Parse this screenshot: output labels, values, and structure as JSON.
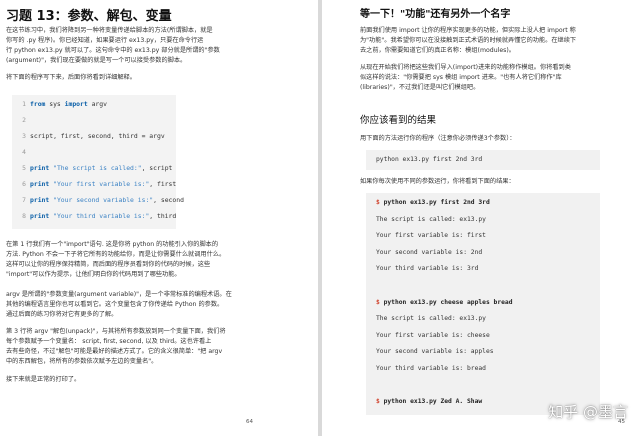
{
  "left_page": {
    "title": "习题 13：参数、解包、变量",
    "intro_lines": [
      "在这节练习中，我们将降到另一种将变量传递给脚本的方法(所谓脚本，就是",
      "你写的 .py 程序)。你已经知道，如果要运行 ex13.py，只要在命令行运",
      "行 python ex13.py 就可以了。这句命令中的 ex13.py 部分就是所谓的\"参数",
      "(argument)\"，我们现在要做的就是写一个可以接受参数的脚本。"
    ],
    "lead_in": "将下面的程序写下来，后面你将看到详细解释。",
    "code_lines": [
      {
        "num": "1",
        "text": "from sys import argv"
      },
      {
        "num": "2",
        "text": ""
      },
      {
        "num": "3",
        "text": "script, first, second, third = argv"
      },
      {
        "num": "4",
        "text": ""
      },
      {
        "num": "5",
        "text": "print \"The script is called:\", script"
      },
      {
        "num": "6",
        "text": "print \"Your first variable is:\", first"
      },
      {
        "num": "7",
        "text": "print \"Your second variable is:\", second"
      },
      {
        "num": "8",
        "text": "print \"Your third variable is:\", third"
      }
    ],
    "para1_lines": [
      "在第 1 行我们有一个\"import\"语句. 这是你将 python 的功能引入你的脚本的",
      "方法. Python 不会一下子将它所有的功能给你，而是让你需要什么就调用什么。",
      "这样可以让你的程序保持精简，而后面的程序员看到你的代码的时候，这些",
      "\"import\"可以作为提示，让他们明白你的代码用到了哪些功能。"
    ],
    "para2_lines": [
      "argv 是所谓的\"参数变量(argument variable)\"，是一个非常标准的编程术语。在",
      "其他的编程语言里你也可以看到它。这个变量包含了你传递给 Python 的参数。",
      "通过后面的练习你将对它有更多的了解。"
    ],
    "para3_lines": [
      "第 3 行将 argv \"解包(unpack)\"，与其将所有参数放到同一个变量下面，我们将",
      "每个参数赋予一个变量名： script, first, second, 以及 third。这也许看上",
      "去有些奇怪，不过\"解包\"可能是最好的描述方式了。它的含义很简单：\"把 argv",
      "中的东西解包，将所有的参数依次赋予左边的变量名\"。"
    ],
    "para4": "接下来就是正常的打印了。",
    "page_number": "64"
  },
  "right_page": {
    "heading1": "等一下！\"功能\"还有另外一个名字",
    "para1_lines": [
      "前面我们使用 import 让你的程序实现更多的功能，但实际上没人把 import 称",
      "为\"功能\"。我希望你可以在没接触到正式术语的时候就弄懂它的功能。在继续下",
      "去之前，你需要知道它们的真正名称：模组(modules)。"
    ],
    "para2_lines": [
      "从现在开始我们将把这些我们导入(import)进来的功能称作模组。你将看到类",
      "似这样的说法：\"你需要把 sys 模组 import 进来。\"也有人将它们称作\"库",
      "(libraries)\"，不过我们还是叫它们模组吧。"
    ],
    "heading2": "你应该看到的结果",
    "run_intro": "用下面的方法运行你的程序（注意你必须传递3个参数）：",
    "run_command": "python ex13.py first 2nd 3rd",
    "output_intro": "如果你每次使用不同的参数运行，你将看到下面的结果：",
    "prompt_symbol": "$",
    "output_lines": [
      {
        "text": "python ex13.py first 2nd 3rd",
        "prompt": true
      },
      {
        "text": "The script is called: ex13.py",
        "prompt": false
      },
      {
        "text": "Your first variable is: first",
        "prompt": false
      },
      {
        "text": "Your second variable is: 2nd",
        "prompt": false
      },
      {
        "text": "Your third variable is: 3rd",
        "prompt": false
      },
      {
        "text": "",
        "prompt": false
      },
      {
        "text": "python ex13.py cheese apples bread",
        "prompt": true
      },
      {
        "text": "The script is called: ex13.py",
        "prompt": false
      },
      {
        "text": "Your first variable is: cheese",
        "prompt": false
      },
      {
        "text": "Your second variable is: apples",
        "prompt": false
      },
      {
        "text": "Your third variable is: bread",
        "prompt": false
      },
      {
        "text": "",
        "prompt": false
      },
      {
        "text": "python ex13.py Zed A. Shaw",
        "prompt": true
      }
    ],
    "page_number": "45"
  },
  "watermark": "知乎 @墨言"
}
